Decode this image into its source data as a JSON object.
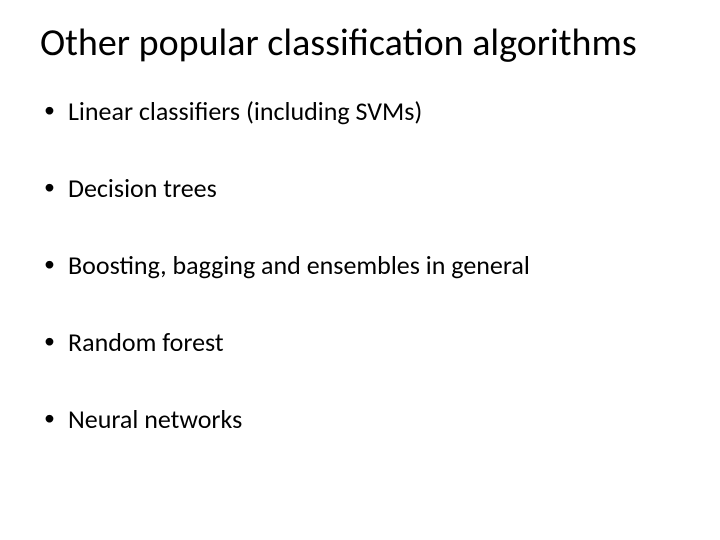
{
  "slide": {
    "title": "Other popular classification algorithms",
    "bullets": [
      "Linear classifiers (including SVMs)",
      "Decision trees",
      "Boosting, bagging and ensembles in general",
      "Random forest",
      "Neural networks"
    ]
  }
}
